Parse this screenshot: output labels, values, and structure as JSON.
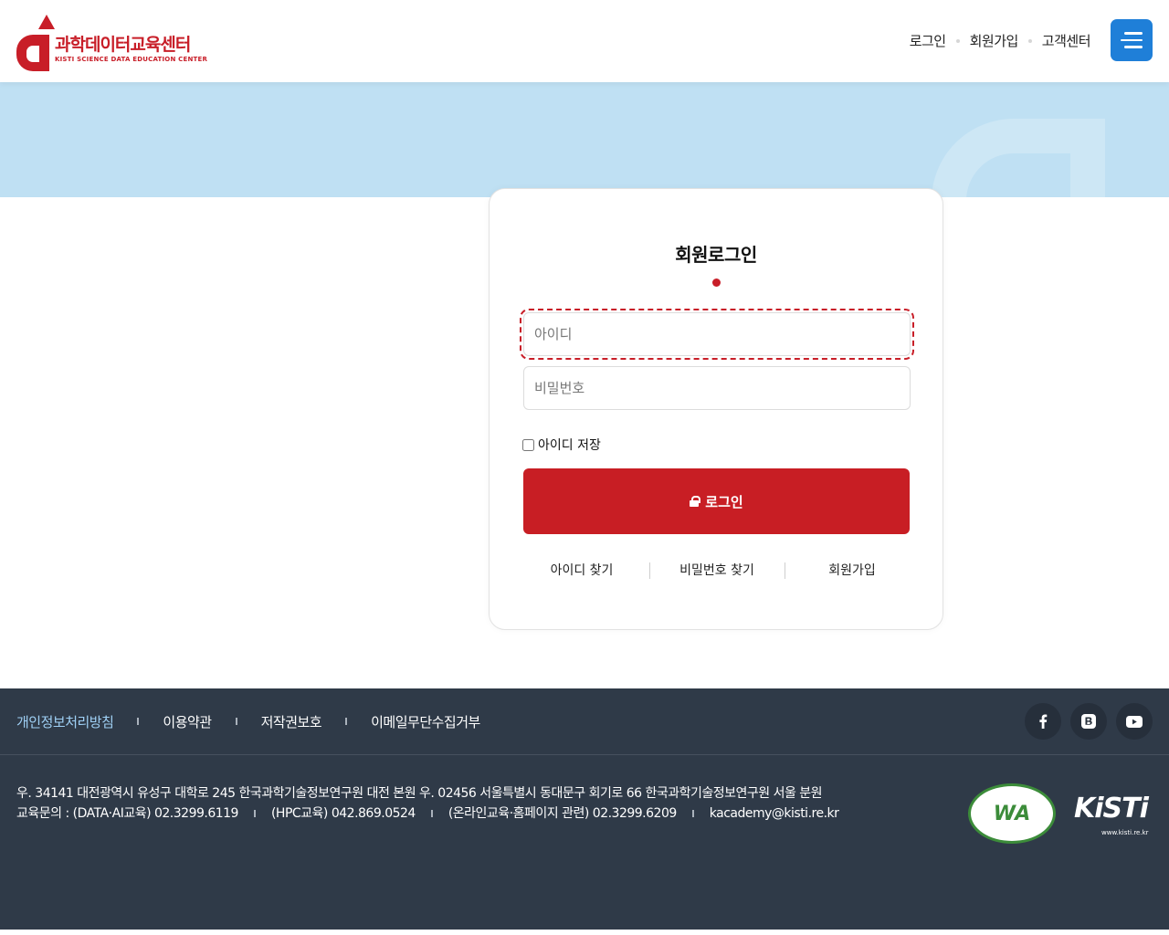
{
  "header": {
    "logo_kr": "과학데이터교육센터",
    "logo_en": "KISTI SCIENCE DATA EDUCATION CENTER",
    "nav": [
      "로그인",
      "회원가입",
      "고객센터"
    ],
    "menu_icon": "hamburger-menu-icon"
  },
  "login": {
    "title": "회원로그인",
    "id_placeholder": "아이디",
    "pw_placeholder": "비밀번호",
    "save_id_label": "아이디 저장",
    "login_button": "로그인",
    "lock_icon": "lock-icon",
    "links": [
      "아이디 찾기",
      "비밀번호 찾기",
      "회원가입"
    ]
  },
  "footer": {
    "links": [
      "개인정보처리방침",
      "이용약관",
      "저작권보호",
      "이메일무단수집거부"
    ],
    "sns": [
      "facebook-icon",
      "blog-icon",
      "youtube-icon"
    ],
    "address": "우. 34141 대전광역시 유성구 대학로 245 한국과학기술정보연구원 대전 본원 우. 02456 서울특별시 동대문구 회기로 66 한국과학기술정보연구원 서울 분원",
    "contacts": [
      "교육문의 : (DATA·AI교육) 02.3299.6119",
      "(HPC교육) 042.869.0524",
      "(온라인교육·홈페이지 관련) 02.3299.6209",
      "kacademy@kisti.re.kr"
    ],
    "wa_badge": "WA",
    "kisti_logo": "KiSTi",
    "kisti_url": "www.kisti.re.kr"
  },
  "colors": {
    "brand_red": "#c81e28",
    "menu_blue": "#1f7fd8",
    "banner_blue": "#bfe0f3",
    "footer_bg": "#2f3a48",
    "footer_link_highlight": "#9fd0f5"
  }
}
